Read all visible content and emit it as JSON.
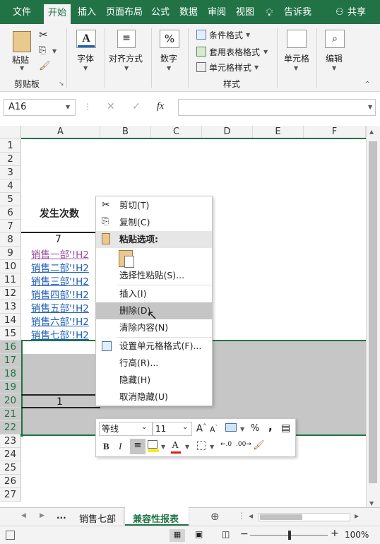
{
  "tabs": [
    {
      "label": "文件"
    },
    {
      "label": "开始"
    },
    {
      "label": "插入"
    },
    {
      "label": "页面布局"
    },
    {
      "label": "公式"
    },
    {
      "label": "数据"
    },
    {
      "label": "审阅"
    },
    {
      "label": "视图"
    },
    {
      "label": "告诉我"
    },
    {
      "label": "共享"
    }
  ],
  "ribbon": {
    "paste": "粘贴",
    "clipboard": "剪贴板",
    "font": "字体",
    "align": "对齐方式",
    "number": "数字",
    "cond_format": "条件格式",
    "table_format": "套用表格格式",
    "cell_style": "单元格样式",
    "styles": "样式",
    "cells": "单元格",
    "edit": "编辑"
  },
  "formula": {
    "name_box": "A16",
    "fx": "fx",
    "value": ""
  },
  "columns": [
    "A",
    "B",
    "C",
    "D",
    "E",
    "F"
  ],
  "rows": [
    "1",
    "2",
    "3",
    "4",
    "5",
    "6",
    "7",
    "8",
    "9",
    "10",
    "11",
    "12",
    "13",
    "14",
    "15",
    "16",
    "17",
    "18",
    "19",
    "20",
    "21",
    "22",
    "23",
    "24",
    "25",
    "26",
    "27"
  ],
  "cells": {
    "header": "发生次数",
    "count": "7",
    "links": [
      "销售一部'!H2",
      "销售二部'!H2",
      "销售三部'!H2",
      "销售四部'!H2",
      "销售五部'!H2",
      "销售六部'!H2",
      "销售七部'!H2"
    ],
    "sum": "1"
  },
  "context_menu": {
    "cut": "剪切(T)",
    "copy": "复制(C)",
    "paste_options": "粘贴选项:",
    "paste_special": "选择性粘贴(S)...",
    "insert": "插入(I)",
    "delete": "删除(D)",
    "clear": "清除内容(N)",
    "format_cells": "设置单元格格式(F)...",
    "row_height": "行高(R)...",
    "hide": "隐藏(H)",
    "unhide": "取消隐藏(U)"
  },
  "mini_toolbar": {
    "font": "等线",
    "size": "11",
    "percent": "%",
    "comma": ",",
    "bold": "B",
    "italic": "I",
    "font_color": "A"
  },
  "sheets": {
    "more": "...",
    "tab1": "销售七部",
    "tab2": "兼容性报表"
  },
  "status": {
    "zoom": "100%"
  },
  "colors": {
    "accent": "#217346",
    "link": "#1f5fb8",
    "selection": "#c6c6c6"
  }
}
